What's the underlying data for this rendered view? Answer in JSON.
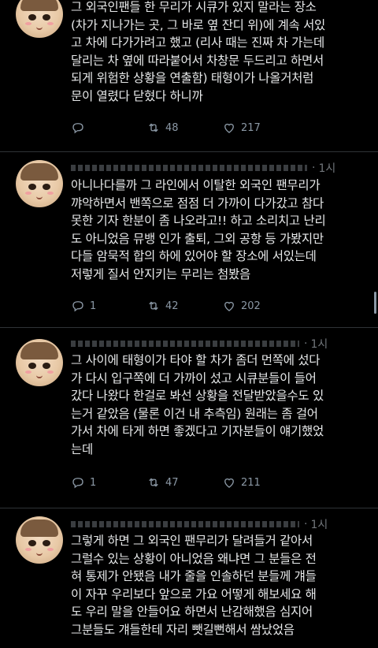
{
  "tweets": [
    {
      "text": "그 외국인팬들 한 무리가 시큐가 있지 말라는 장소\n(차가 지나가는 곳, 그 바로 옆 잔디 위)에 계속 서있\n고 차에 다가가려고 했고 (리사 때는 진짜 차 가는데\n달리는 차 옆에 따라붙어서 차창문 두드리고 하면서\n되게 위험한 상황을 연출함) 태형이가 나올거처럼\n문이 열렸다 닫혔다 하니까",
      "replies": "",
      "retweets": "48",
      "likes": "217"
    },
    {
      "time": "1시",
      "text": "아니나다를까 그 라인에서 이탈한 외국인 팬무리가\n꺄악하면서 밴쪽으로 점점 더 가까이 다가갔고 참다\n못한 기자 한분이 좀 나오라고!! 하고 소리치고 난리\n도 아니었음 뮤뱅 인가 출퇴, 그외 공항 등 가봤지만\n다들 암묵적 합의 하에 있어야 할 장소에 서있는데\n저렇게 질서 안지키는 무리는 첨봤음",
      "replies": "1",
      "retweets": "42",
      "likes": "202"
    },
    {
      "time": "1시",
      "text": "그 사이에 태형이가 타야 할 차가 좀더 먼쪽에 섰다\n가 다시 입구쪽에 더 가까이 섰고 시큐분들이 들어\n갔다 나왔다 한걸로 봐선 상황을 전달받았을수도 있\n는거 같았음 (물론 이건 내 추측임) 원래는 좀 걸어\n가서 차에 타게 하면 좋겠다고 기자분들이 얘기했었\n는데",
      "replies": "1",
      "retweets": "47",
      "likes": "211"
    },
    {
      "time": "1시",
      "text": "그렇게 하면 그 외국인 팬무리가 달려들거 같아서\n그럴수 있는 상황이 아니었음 왜냐면 그 분들은 전\n혀 통제가 안됐음 내가 줄을 인솔하던 분들께 걔들\n이 자꾸 우리보다 앞으로 가요 어떻게 해보세요 해\n도 우리 말을 안들어요 하면서 난감해했음 심지어\n그분들도 걔들한테  자리 뺏길뻔해서 쌈났었음"
    }
  ],
  "icons": {
    "reply": "reply-icon",
    "retweet": "retweet-icon",
    "like": "heart-icon",
    "avatar": "profile-avatar"
  },
  "colors": {
    "background": "#000000",
    "text": "#e7e9ea",
    "secondary": "#71767b",
    "divider": "#2f3336"
  }
}
